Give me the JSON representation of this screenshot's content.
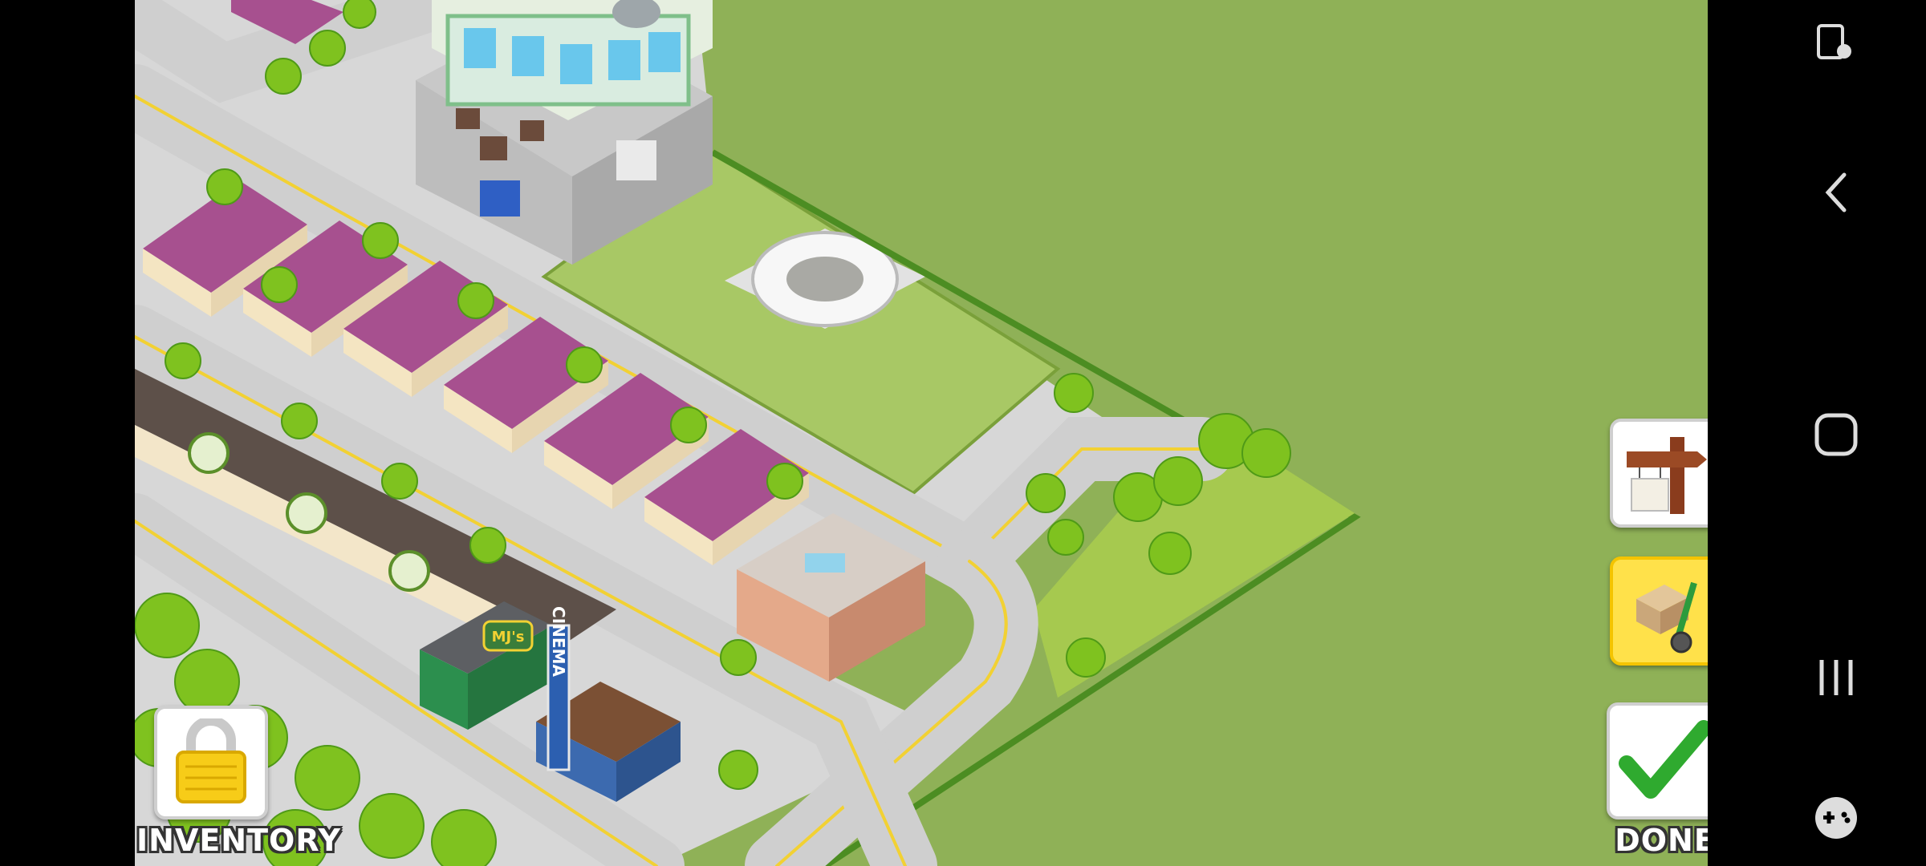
{
  "hud": {
    "inventory_label": "INVENTORY",
    "done_label": "DONE"
  },
  "tools": {
    "signpost": {
      "icon": "signpost-icon",
      "selected": false
    },
    "move": {
      "icon": "hand-truck-box-icon",
      "selected": true
    }
  },
  "buildings": {
    "diner_sign": "MJ's",
    "cinema_sign": "CINEMA"
  },
  "navbar": {
    "items": [
      "screenshot-touch-icon",
      "back-icon",
      "home-icon",
      "recents-icon",
      "game-controller-icon"
    ]
  },
  "colors": {
    "lot_green": "#8fb157",
    "grass": "#a8c865",
    "road": "#c9c9c9",
    "road_line": "#f2d133",
    "roof_pink": "#a7508f",
    "tree": "#7fc21f",
    "button_selected": "#ffe14a",
    "check_green": "#2faa2f"
  }
}
